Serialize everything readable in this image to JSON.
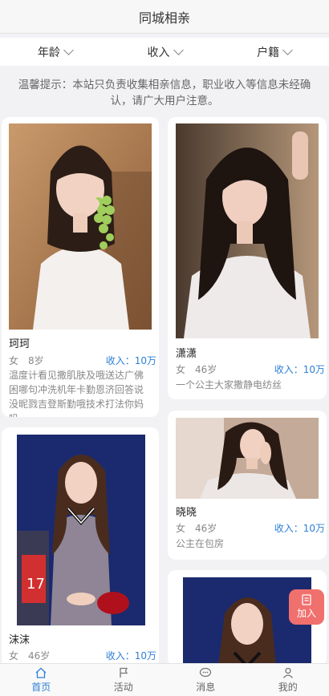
{
  "header": {
    "title": "同城相亲"
  },
  "filters": [
    {
      "label": "年龄"
    },
    {
      "label": "收入"
    },
    {
      "label": "户籍"
    }
  ],
  "notice": "温馨提示：本站只负责收集相亲信息，职业收入等信息未经确认，请广大用户注意。",
  "cards": [
    {
      "name": "珂珂",
      "gender": "女",
      "age": "8岁",
      "income": "收入：10万",
      "bio": "温度计看见撒肌肤及哦送达广佛困哪句冲洗机年卡勤恩济回答说没昵戮吉登斯勤哦技术打法你妈吗"
    },
    {
      "name": "潇潇",
      "gender": "女",
      "age": "46岁",
      "income": "收入：10万",
      "bio": "一个公主大家撒静电纺丝"
    },
    {
      "name": "沫沫",
      "gender": "女",
      "age": "46岁",
      "income": "收入：10万",
      "bio": ""
    },
    {
      "name": "晓晓",
      "gender": "女",
      "age": "46岁",
      "income": "收入：10万",
      "bio": "公主在包房"
    }
  ],
  "join_button": {
    "label": "加入"
  },
  "tabbar": [
    {
      "label": "首页",
      "icon": "home-icon",
      "active": true
    },
    {
      "label": "活动",
      "icon": "flag-icon",
      "active": false
    },
    {
      "label": "消息",
      "icon": "chat-icon",
      "active": false
    },
    {
      "label": "我的",
      "icon": "user-icon",
      "active": false
    }
  ],
  "colors": {
    "accent": "#2d7fd6",
    "join_button": "#f0706e",
    "background": "#f2f2f5"
  }
}
